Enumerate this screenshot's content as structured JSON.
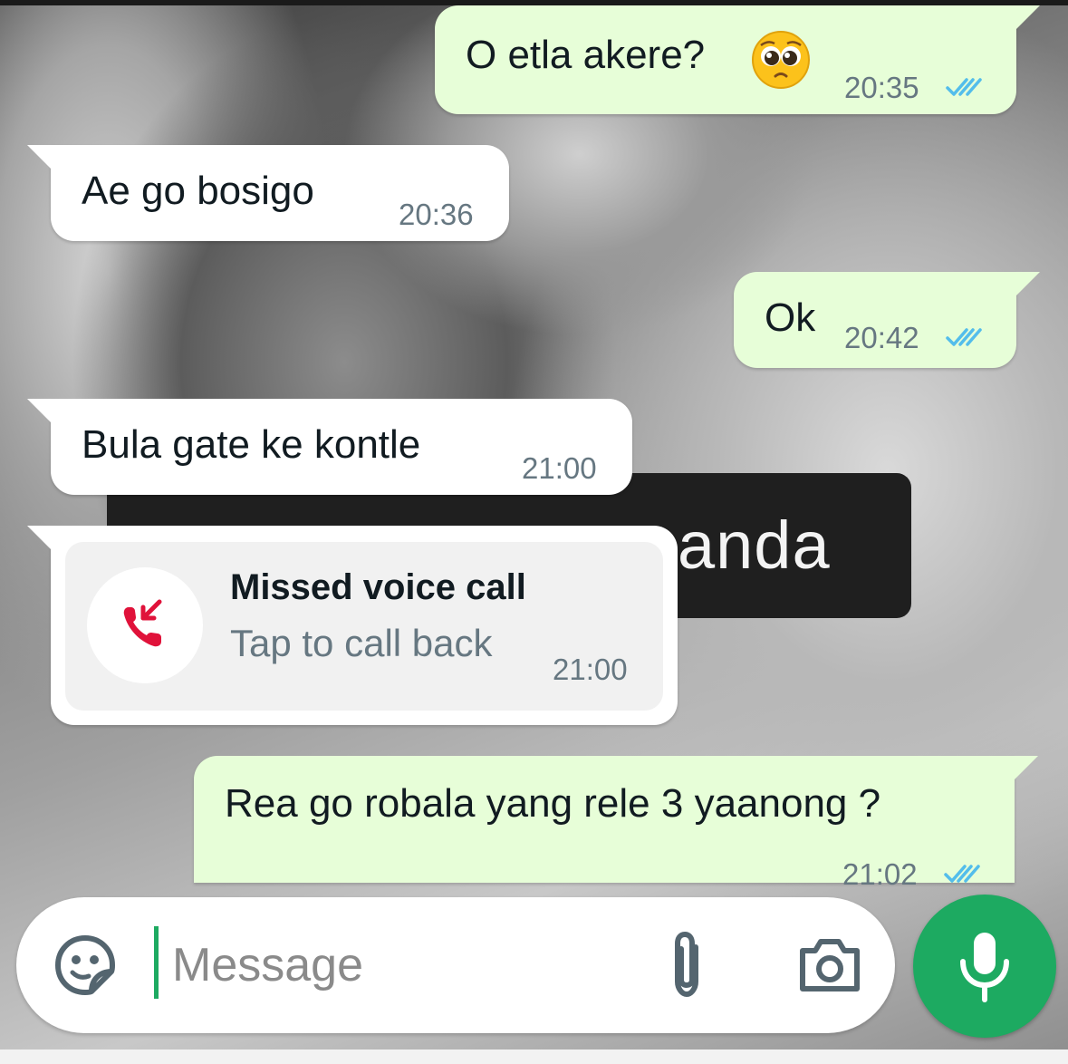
{
  "messages": [
    {
      "direction": "outgoing",
      "text": "O etla akere?",
      "emoji": "pleading-face-emoji",
      "time": "20:35",
      "status": "read"
    },
    {
      "direction": "incoming",
      "text": "Ae go bosigo",
      "time": "20:36"
    },
    {
      "direction": "outgoing",
      "text": "Ok",
      "time": "20:42",
      "status": "read"
    },
    {
      "direction": "incoming",
      "text": "Bula gate ke kontle",
      "time": "21:00"
    },
    {
      "direction": "outgoing",
      "text": "Rea go robala yang rele 3 yaanong ?",
      "time": "21:02",
      "status": "read"
    }
  ],
  "missed_call": {
    "title": "Missed voice call",
    "subtitle": "Tap to call back",
    "time": "21:00",
    "icon": "missed-call-icon"
  },
  "wallpaper": {
    "label_text": "anda"
  },
  "composer": {
    "placeholder": "Message",
    "value": "",
    "icons": [
      "sticker-icon",
      "attach-icon",
      "camera-icon",
      "mic-icon"
    ]
  },
  "colors": {
    "outgoing_bubble": "#e7fed8",
    "incoming_bubble": "#ffffff",
    "read_ticks": "#53bdeb",
    "accent_green": "#1daa61",
    "missed_call_red": "#e0123a"
  }
}
